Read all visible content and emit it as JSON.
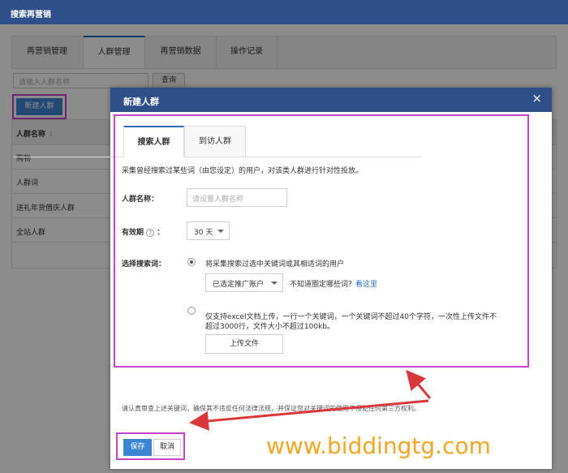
{
  "app": {
    "title": "搜索再营销"
  },
  "tabs": [
    {
      "label": "再营销管理"
    },
    {
      "label": "人群管理"
    },
    {
      "label": "再营销数据"
    },
    {
      "label": "操作记录"
    }
  ],
  "search": {
    "placeholder": "请输入人群名称",
    "query_button": "查询"
  },
  "new_group_button": "新建人群",
  "table": {
    "header": "人群名称",
    "sort_icon": "↓",
    "rows": [
      "购物",
      "人群词",
      "送礼年货借庆人群",
      "全站人群"
    ]
  },
  "modal": {
    "title": "新建人群",
    "close": "×",
    "tabs": [
      {
        "label": "搜索人群"
      },
      {
        "label": "到访人群"
      }
    ],
    "description": "采集曾经搜索过某些词（由您设定）的用户，对该类人群进行针对性投放。",
    "name_label": "人群名称：",
    "name_placeholder": "请设置人群名称",
    "validity_label": "有效期",
    "validity_help": "?",
    "validity_colon": "：",
    "validity_value": "30 天",
    "keywords_label": "选择搜索词：",
    "option1_text": "将采集搜索过选中关键词或其相适词的用户",
    "account_select": "已选定推广账户",
    "hint_text": "不知道圈定哪些词？",
    "hint_link": "看这里",
    "option2_line1": "仅支持excel文档上传，一行一个关键词，一个关键词不超过40个字符，一次性上传文件不",
    "option2_line2": "超过3000行，文件大小不超过100kb。",
    "upload_button": "上传文件",
    "footnote": "请认真审查上述关键词，确保其不违反任何法律法规，并保证您对关键词的使用不侵犯任何第三方权利。",
    "save_button": "保存",
    "cancel_button": "取消"
  },
  "watermark": "www.biddingtg.com",
  "colors": {
    "header": "#2e4f87",
    "primary": "#3c85d2",
    "highlight": "#c545c8",
    "arrow": "#d9373a",
    "watermark": "#f5a623"
  }
}
